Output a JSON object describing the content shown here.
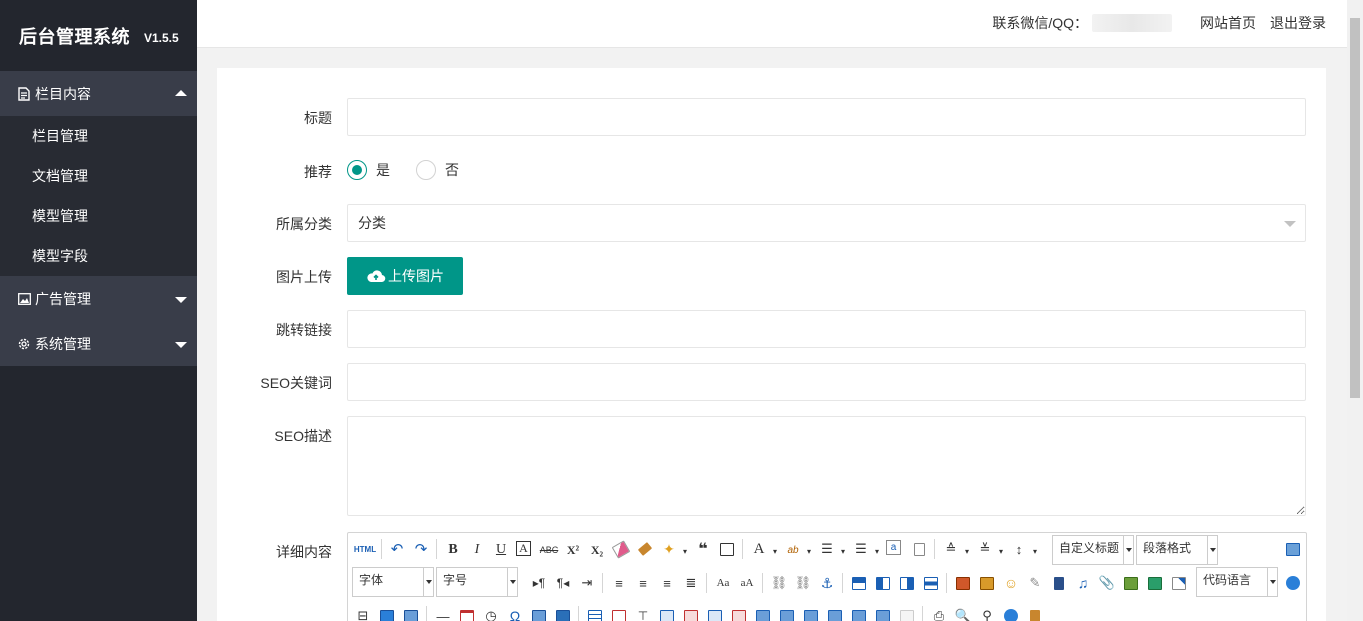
{
  "sidebar": {
    "title": "后台管理系统",
    "version": "V1.5.5",
    "groups": [
      {
        "label": "栏目内容",
        "icon": "document-icon",
        "open": true,
        "items": [
          {
            "label": "栏目管理"
          },
          {
            "label": "文档管理"
          },
          {
            "label": "模型管理"
          },
          {
            "label": "模型字段"
          }
        ]
      },
      {
        "label": "广告管理",
        "icon": "image-icon",
        "open": false
      },
      {
        "label": "系统管理",
        "icon": "gear-icon",
        "open": false
      }
    ]
  },
  "header": {
    "contact_label": "联系微信/QQ：",
    "site_home": "网站首页",
    "logout": "退出登录"
  },
  "form": {
    "title_label": "标题",
    "title_value": "",
    "recommend_label": "推荐",
    "recommend_yes": "是",
    "recommend_no": "否",
    "category_label": "所属分类",
    "category_value": "分类",
    "image_label": "图片上传",
    "upload_button": "上传图片",
    "link_label": "跳转链接",
    "link_value": "",
    "seo_keywords_label": "SEO关键词",
    "seo_keywords_value": "",
    "seo_desc_label": "SEO描述",
    "content_label": "详细内容"
  },
  "editor": {
    "html_label": "HTML",
    "custom_title": "自定义标题",
    "paragraph_format": "段落格式",
    "font_family": "字体",
    "font_size": "字号",
    "code_language": "代码语言",
    "accent_color": "#009688"
  }
}
